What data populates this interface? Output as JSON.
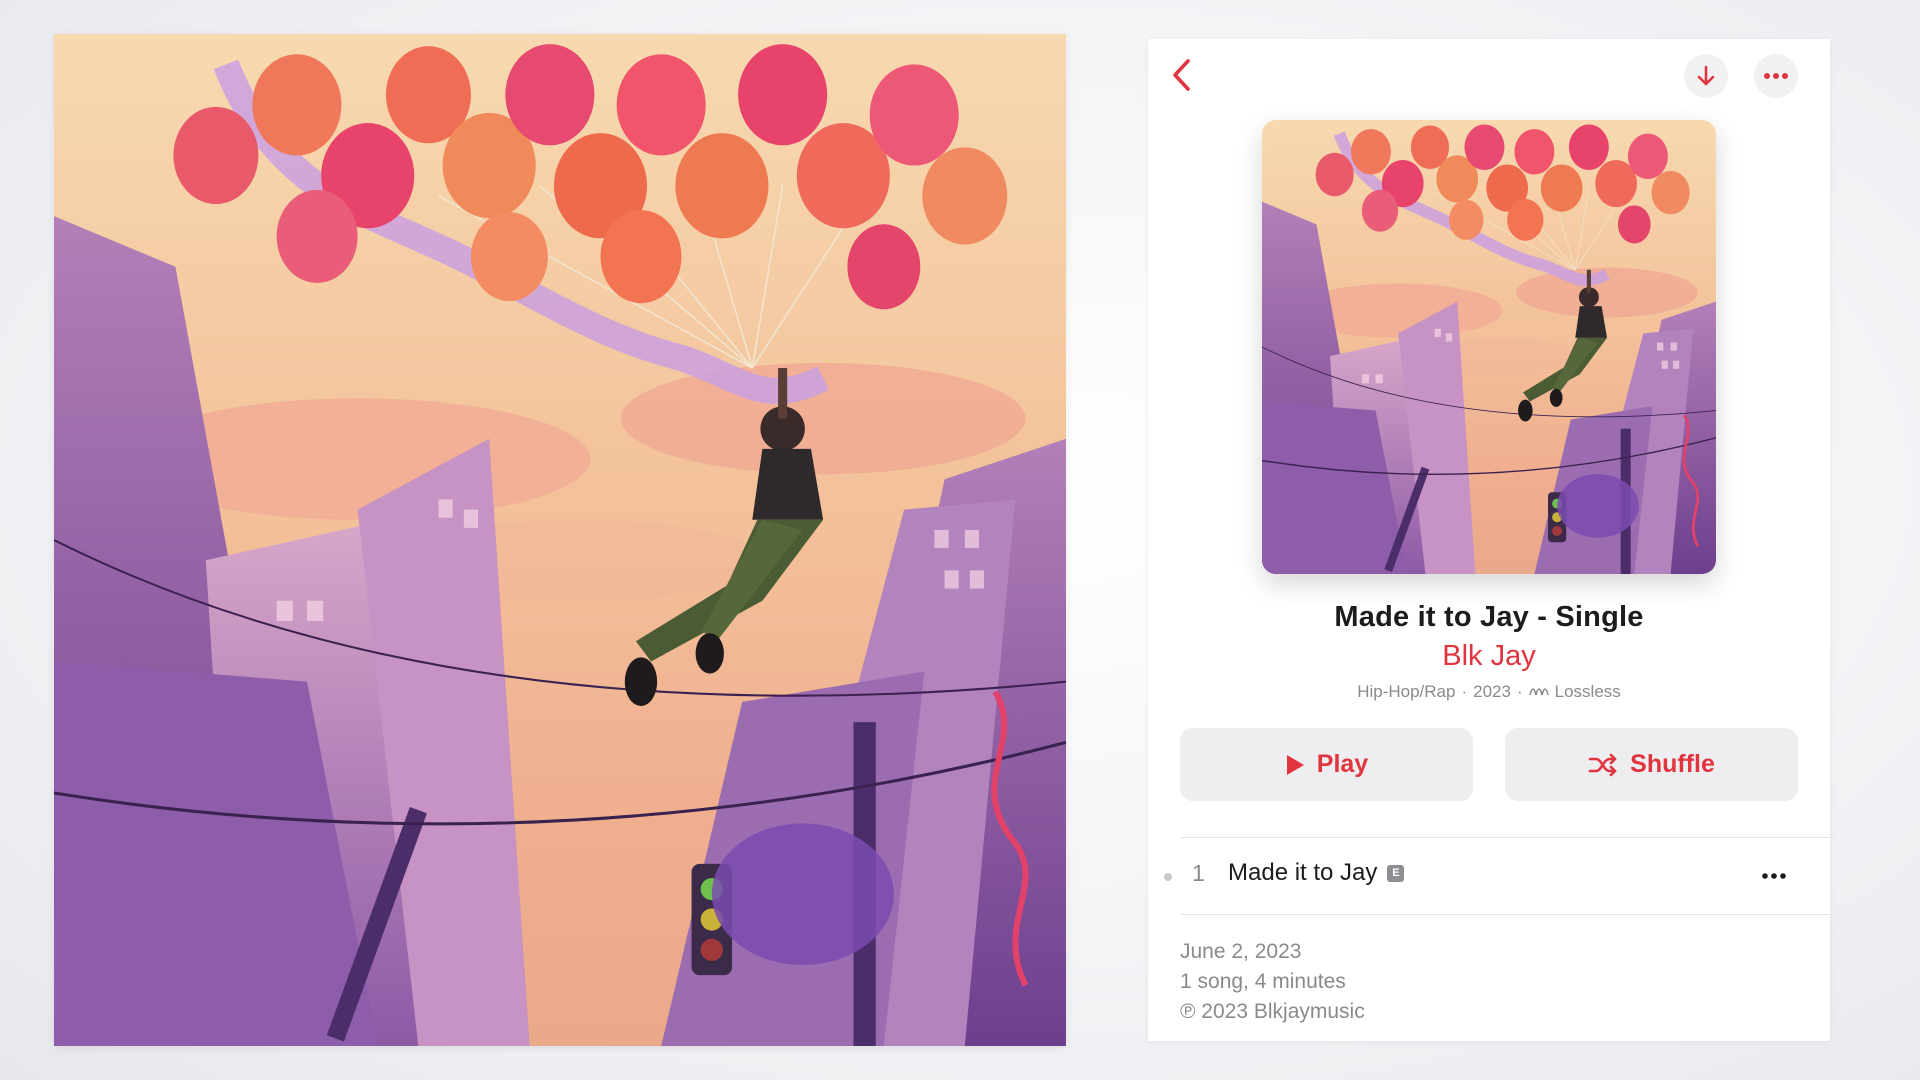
{
  "album": {
    "title": "Made it to Jay - Single",
    "artist": "Blk Jay",
    "genre": "Hip-Hop/Rap",
    "year": "2023",
    "quality": "Lossless",
    "separator": "·"
  },
  "actions": {
    "play_label": "Play",
    "shuffle_label": "Shuffle"
  },
  "tracks": [
    {
      "number": "1",
      "title": "Made it to Jay",
      "explicit_badge": "E"
    }
  ],
  "footer": {
    "release_date": "June 2, 2023",
    "summary": "1 song, 4 minutes",
    "copyright": "℗ 2023 Blkjaymusic"
  },
  "icons": {
    "back": "chevron-left-icon",
    "download": "arrow-down-icon",
    "more": "ellipsis-icon",
    "play": "play-icon",
    "shuffle": "shuffle-icon",
    "lossless": "lossless-wave-icon",
    "explicit": "explicit-badge-icon"
  },
  "colors": {
    "accent": "#e0353f",
    "button_bg": "#eeeef0",
    "secondary_text": "#8a8a8e",
    "primary_text": "#1c1c1e"
  }
}
